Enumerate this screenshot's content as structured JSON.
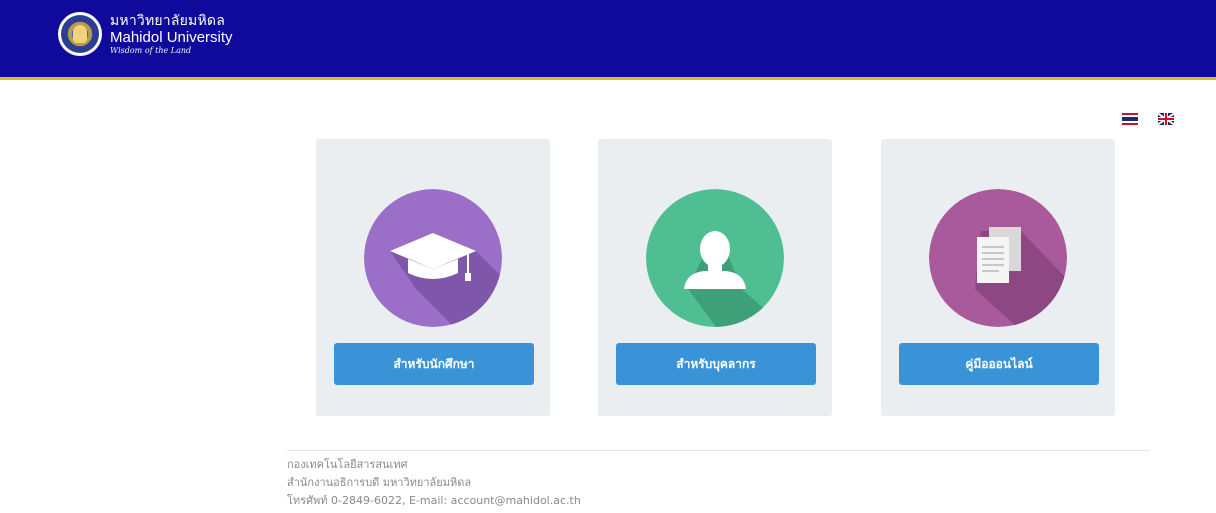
{
  "header": {
    "brand_th": "มหาวิทยาลัยมหิดล",
    "brand_en": "Mahidol University",
    "brand_motto": "Wisdom of the Land",
    "bg_color": "#0f0a9c",
    "accent_color": "#e5b81c"
  },
  "languages": [
    {
      "code": "th",
      "icon": "thai-flag-icon"
    },
    {
      "code": "en",
      "icon": "uk-flag-icon"
    }
  ],
  "cards": [
    {
      "icon": "graduation-cap-icon",
      "circle_color": "#9b6fc8",
      "button_label": "สำหรับนักศึกษา"
    },
    {
      "icon": "user-silhouette-icon",
      "circle_color": "#4fbf93",
      "button_label": "สำหรับบุคลากร"
    },
    {
      "icon": "document-icon",
      "circle_color": "#a85a9c",
      "button_label": "คู่มือออนไลน์"
    }
  ],
  "button_color": "#3a93d6",
  "footer": {
    "line1": "กองเทคโนโลยีสารสนเทศ",
    "line2": "สำนักงานอธิการบดี มหาวิทยาลัยมหิดล",
    "line3": "โทรศัพท์ 0-2849-6022, E-mail: account@mahidol.ac.th"
  }
}
